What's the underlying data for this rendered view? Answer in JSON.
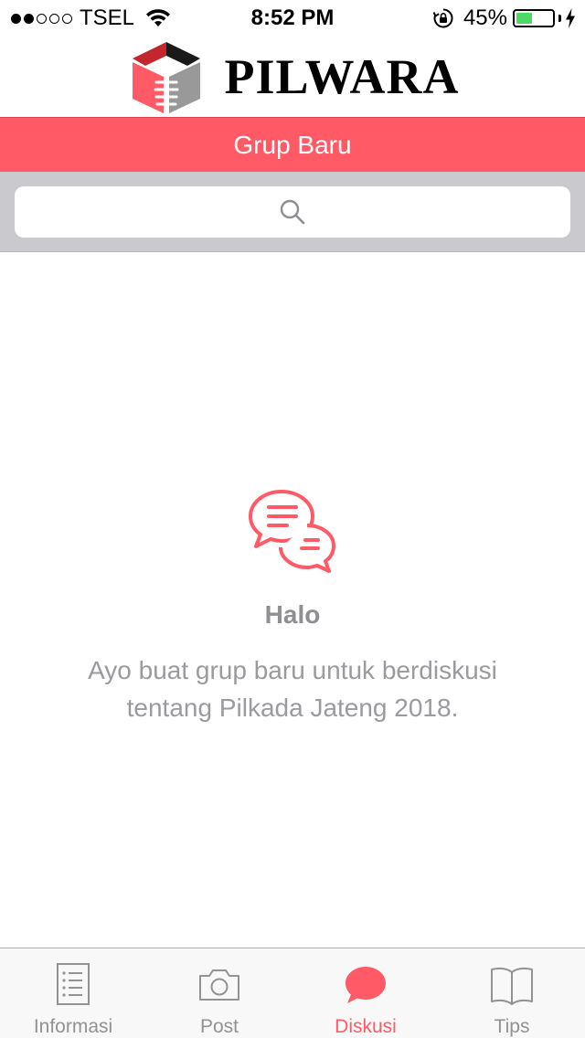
{
  "status_bar": {
    "carrier": "TSEL",
    "signal_bars_filled": 2,
    "signal_bars_total": 5,
    "time": "8:52 PM",
    "battery_percent": "45%",
    "battery_level": 0.45
  },
  "header": {
    "logo_text": "PILWARA"
  },
  "nav": {
    "title": "Grup Baru"
  },
  "search": {
    "placeholder": "",
    "value": ""
  },
  "empty_state": {
    "icon": "chat-bubbles-icon",
    "title": "Halo",
    "message": "Ayo buat grup baru untuk berdiskusi tentang Pilkada Jateng 2018."
  },
  "tabs": [
    {
      "label": "Informasi",
      "icon": "list-icon",
      "active": false
    },
    {
      "label": "Post",
      "icon": "camera-icon",
      "active": false
    },
    {
      "label": "Diskusi",
      "icon": "chat-bubble-icon",
      "active": true
    },
    {
      "label": "Tips",
      "icon": "book-icon",
      "active": false
    }
  ],
  "colors": {
    "accent": "#ff5a66",
    "inactive_tab": "#929292",
    "battery": "#4cd964",
    "search_bg": "#c9c9ce"
  }
}
